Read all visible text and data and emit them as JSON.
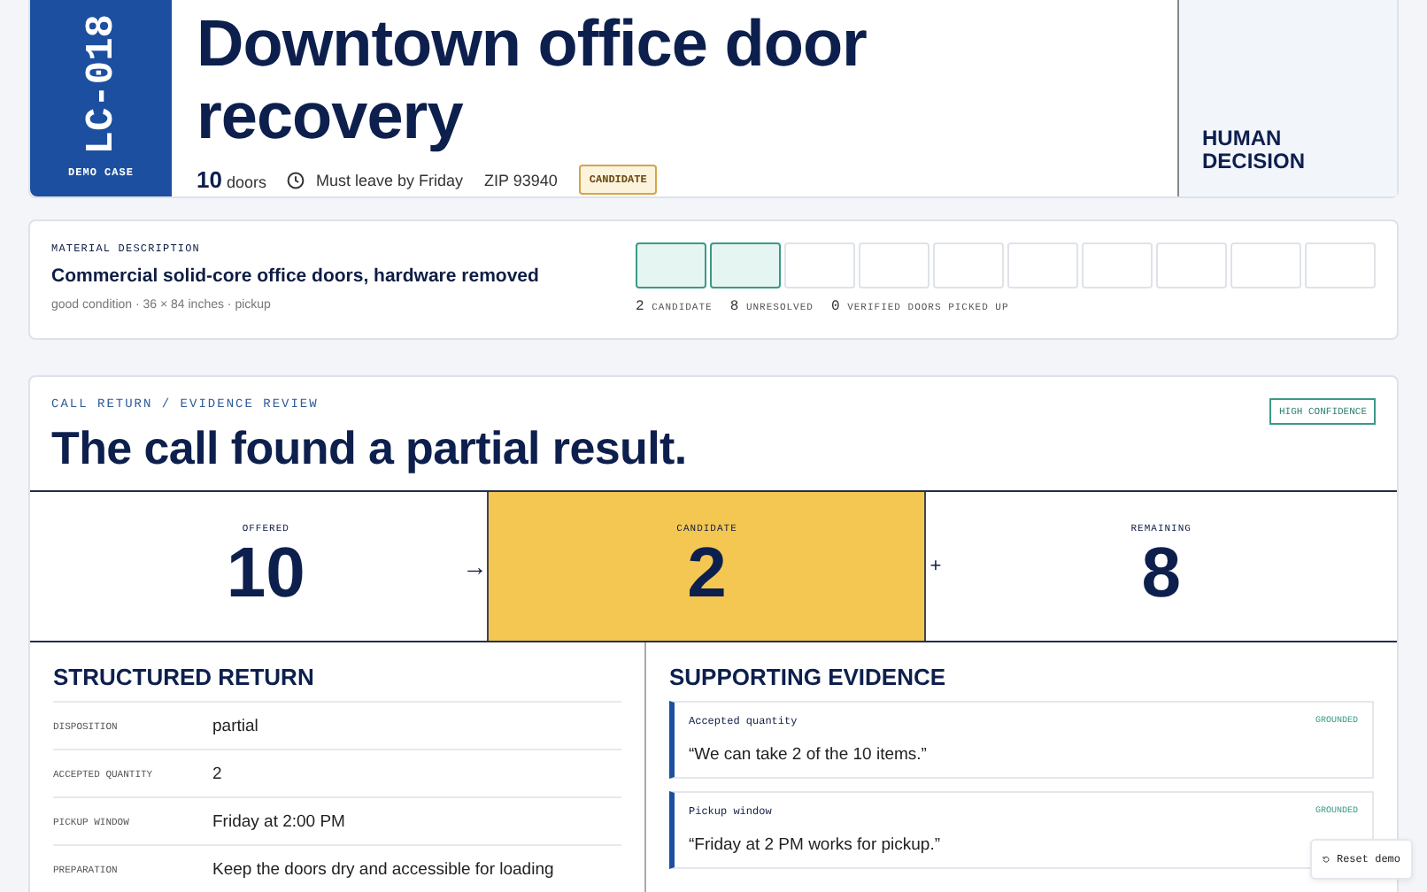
{
  "case": {
    "code": "LC-018",
    "tag": "DEMO CASE",
    "title": "Downtown office door recovery",
    "count": "10",
    "count_unit": "doors",
    "deadline": "Must leave by Friday",
    "zip": "ZIP 93940",
    "badge": "CANDIDATE",
    "decision": "HUMAN DECISION"
  },
  "material": {
    "label": "MATERIAL DESCRIPTION",
    "name": "Commercial solid-core office doors, hardware removed",
    "details": "good condition · 36 × 84 inches · pickup",
    "slots": [
      {
        "kind": "candidate"
      },
      {
        "kind": "candidate"
      },
      {
        "kind": "unresolved"
      },
      {
        "kind": "unresolved"
      },
      {
        "kind": "unresolved"
      },
      {
        "kind": "unresolved"
      },
      {
        "kind": "unresolved"
      },
      {
        "kind": "unresolved"
      },
      {
        "kind": "unresolved"
      },
      {
        "kind": "unresolved"
      }
    ],
    "counts": [
      {
        "value": "2",
        "label": "CANDIDATE"
      },
      {
        "value": "8",
        "label": "UNRESOLVED"
      },
      {
        "value": "0",
        "label": "VERIFIED DOORS PICKED UP"
      }
    ]
  },
  "review": {
    "eyebrow": "CALL RETURN / EVIDENCE REVIEW",
    "confidence": "HIGH CONFIDENCE",
    "headline": "The call found a partial result.",
    "metrics": [
      {
        "label": "OFFERED",
        "value": "10",
        "selected": false
      },
      {
        "label": "CANDIDATE",
        "value": "2",
        "selected": true
      },
      {
        "label": "REMAINING",
        "value": "8",
        "selected": false
      }
    ],
    "arrow": "→",
    "plus": "+",
    "structured_title": "STRUCTURED RETURN",
    "fields": [
      {
        "label": "DISPOSITION",
        "value": "partial"
      },
      {
        "label": "ACCEPTED QUANTITY",
        "value": "2"
      },
      {
        "label": "PICKUP WINDOW",
        "value": "Friday at 2:00 PM"
      },
      {
        "label": "PREPARATION",
        "value": "Keep the doors dry and accessible for loading"
      }
    ],
    "evidence_title": "SUPPORTING EVIDENCE",
    "evidence": [
      {
        "label": "Accepted quantity",
        "status": "GROUNDED",
        "quote": "“We can take 2 of the 10 items.”"
      },
      {
        "label": "Pickup window",
        "status": "GROUNDED",
        "quote": "“Friday at 2 PM works for pickup.”"
      }
    ]
  },
  "reset_button": "Reset demo"
}
